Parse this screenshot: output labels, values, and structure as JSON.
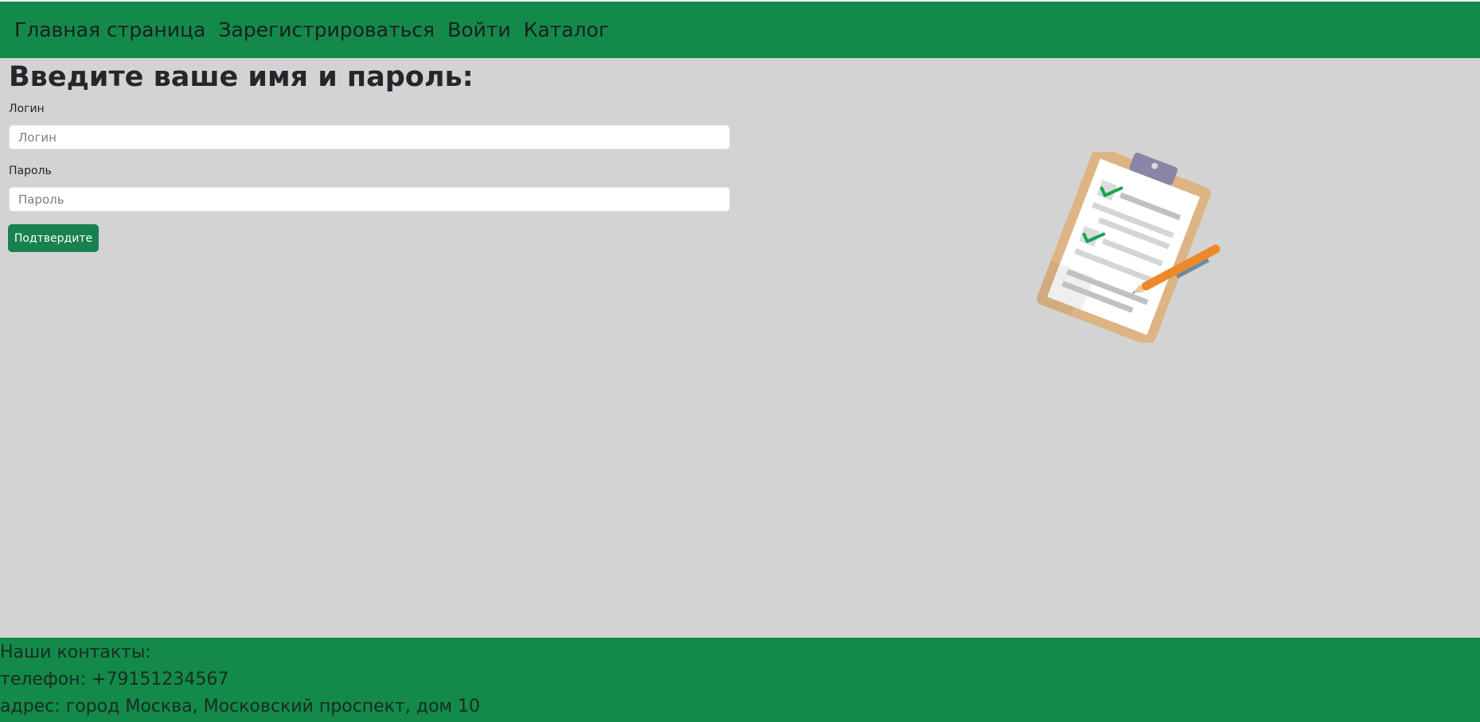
{
  "nav": {
    "links": [
      "Главная страница",
      "Зарегистрироваться",
      "Войти",
      "Каталог"
    ]
  },
  "form": {
    "title": "Введите ваше имя и пароль:",
    "login_label": "Логин",
    "login_placeholder": "Логин",
    "login_value": "",
    "password_label": "Пароль",
    "password_placeholder": "Пароль",
    "password_value": "",
    "submit_label": "Подтвердите"
  },
  "illustration": {
    "icon": "clipboard-checklist-icon"
  },
  "footer": {
    "contacts_title": "Наши контакты:",
    "phone": "телефон: +79151234567",
    "address": "адрес: город Москва, Московский проспект, дом 10"
  },
  "colors": {
    "brand_green": "#138a4a",
    "button_green": "#19804f",
    "content_bg": "#d3d3d3"
  }
}
